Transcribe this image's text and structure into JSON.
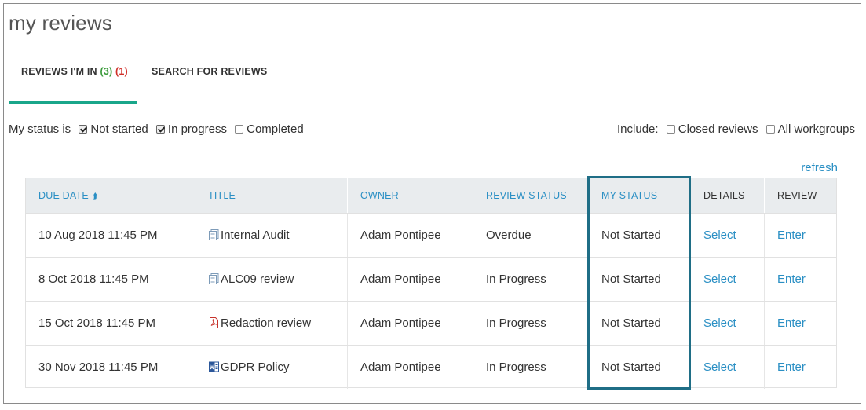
{
  "page": {
    "title": "my reviews"
  },
  "tabs": [
    {
      "label": "REVIEWS I'M IN",
      "count_green": "(3)",
      "count_red": "(1)",
      "active": true
    },
    {
      "label": "SEARCH FOR REVIEWS",
      "active": false
    }
  ],
  "filters": {
    "my_status_label": "My status is",
    "not_started": {
      "label": "Not started",
      "checked": true
    },
    "in_progress": {
      "label": "In progress",
      "checked": true
    },
    "completed": {
      "label": "Completed",
      "checked": false
    },
    "include_label": "Include:",
    "closed_reviews": {
      "label": "Closed reviews",
      "checked": false
    },
    "all_workgroups": {
      "label": "All workgroups",
      "checked": false
    }
  },
  "refresh_label": "refresh",
  "table": {
    "columns": [
      "DUE DATE",
      "TITLE",
      "OWNER",
      "REVIEW STATUS",
      "MY STATUS",
      "DETAILS",
      "REVIEW"
    ],
    "sort_icon": "sort-ascending-icon",
    "rows": [
      {
        "due_date": "10 Aug 2018 11:45 PM",
        "title": "Internal Audit",
        "doc_icon": "document-stack-icon",
        "owner": "Adam Pontipee",
        "review_status": "Overdue",
        "my_status": "Not Started",
        "details": "Select",
        "review": "Enter"
      },
      {
        "due_date": "8 Oct 2018 11:45 PM",
        "title": "ALC09 review",
        "doc_icon": "document-stack-icon",
        "owner": "Adam Pontipee",
        "review_status": "In Progress",
        "my_status": "Not Started",
        "details": "Select",
        "review": "Enter"
      },
      {
        "due_date": "15 Oct 2018 11:45 PM",
        "title": "Redaction review",
        "doc_icon": "pdf-icon",
        "owner": "Adam Pontipee",
        "review_status": "In Progress",
        "my_status": "Not Started",
        "details": "Select",
        "review": "Enter"
      },
      {
        "due_date": "30 Nov 2018 11:45 PM",
        "title": "GDPR Policy",
        "doc_icon": "word-document-icon",
        "owner": "Adam Pontipee",
        "review_status": "In Progress",
        "my_status": "Not Started",
        "details": "Select",
        "review": "Enter"
      }
    ]
  },
  "colors": {
    "accent_teal": "#19a68a",
    "link_blue": "#2a8fc4",
    "highlight_border": "#1f6e86",
    "count_green": "#3a9a3a",
    "count_red": "#d0302a",
    "header_bg": "#e9ecee"
  }
}
